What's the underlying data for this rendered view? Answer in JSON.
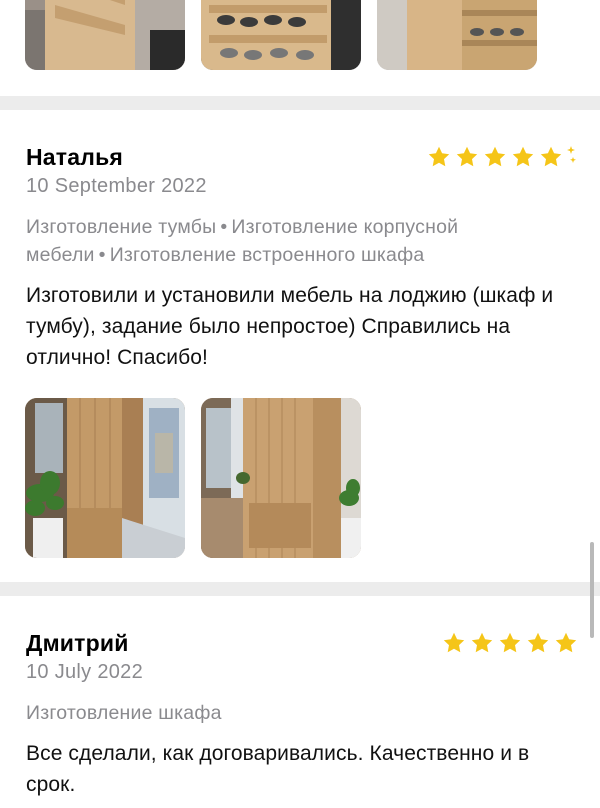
{
  "colors": {
    "star": "#f5c518",
    "muted": "#8a8a8e",
    "divider": "#ececec"
  },
  "reviews": [
    {
      "name": "Наталья",
      "date": "10 September 2022",
      "rating": 5,
      "tags": [
        "Изготовление тумбы",
        "Изготовление корпусной мебели",
        "Изготовление встроенного шкафа"
      ],
      "text": "Изготовили и установили мебель на лоджию (шкаф и тумбу), задание было непростое) Справились на отлично! Спасибо!"
    },
    {
      "name": "Дмитрий",
      "date": "10 July 2022",
      "rating": 5,
      "tags": [
        "Изготовление шкафа"
      ],
      "text": "Все сделали, как договаривались. Качественно и в срок."
    }
  ],
  "icons": [
    "star-icon",
    "sparkle-icon"
  ]
}
